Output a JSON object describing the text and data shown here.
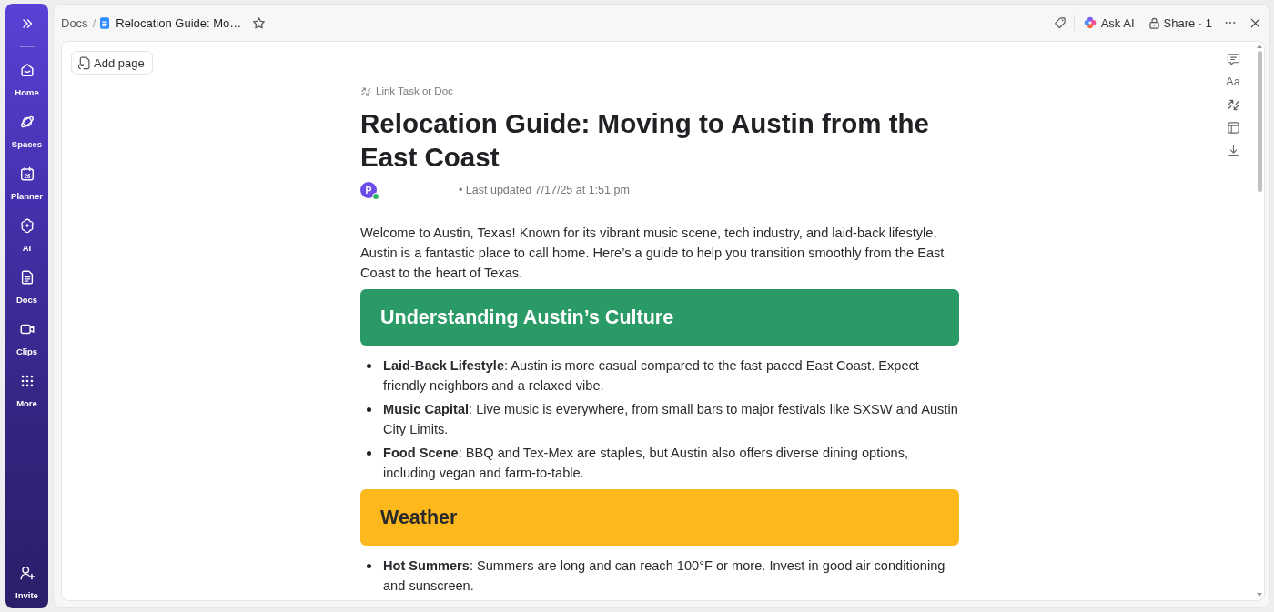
{
  "sidebar": {
    "items": [
      {
        "label": "Home",
        "selected": false
      },
      {
        "label": "Spaces",
        "selected": false
      },
      {
        "label": "Planner",
        "selected": false,
        "icon_text": "26"
      },
      {
        "label": "AI",
        "selected": false
      },
      {
        "label": "Docs",
        "selected": false
      },
      {
        "label": "Clips",
        "selected": false
      },
      {
        "label": "More",
        "selected": false
      }
    ],
    "footer_item": {
      "label": "Invite"
    }
  },
  "topbar": {
    "breadcrumb_root": "Docs",
    "breadcrumb_separator": "/",
    "breadcrumb_current": "Relocation Guide: Mo…",
    "starred": false,
    "ask_ai": "Ask AI",
    "share": "Share · 1"
  },
  "add_page": "Add page",
  "tools": {
    "text_style": "Aa"
  },
  "doc": {
    "link_label": "Link Task or Doc",
    "title": "Relocation Guide: Moving to Austin from the East Coast",
    "author": {
      "initial": "P",
      "online": true
    },
    "updated": "• Last updated 7/17/25 at 1:51 pm",
    "intro": "Welcome to Austin, Texas! Known for its vibrant music scene, tech industry, and laid-back lifestyle, Austin is a fantastic place to call home. Here’s a guide to help you transition smoothly from the East Coast to the heart of Texas.",
    "sections": [
      {
        "heading": "Understanding Austin’s Culture",
        "color": "#2a9a66",
        "items": [
          "**Laid-Back Lifestyle**: Austin is more casual compared to the fast-paced East Coast. Expect friendly neighbors and a relaxed vibe.",
          "**Music Capital**: Live music is everywhere, from small bars to major festivals like SXSW and Austin City Limits.",
          "**Food Scene**: BBQ and Tex-Mex are staples, but Austin also offers diverse dining options, including vegan and farm-to-table."
        ]
      },
      {
        "heading": "Weather",
        "color": "#fdb81e",
        "items": [
          "**Hot Summers**: Summers are long and can reach 100°F or more. Invest in good air conditioning and sunscreen."
        ]
      }
    ]
  }
}
